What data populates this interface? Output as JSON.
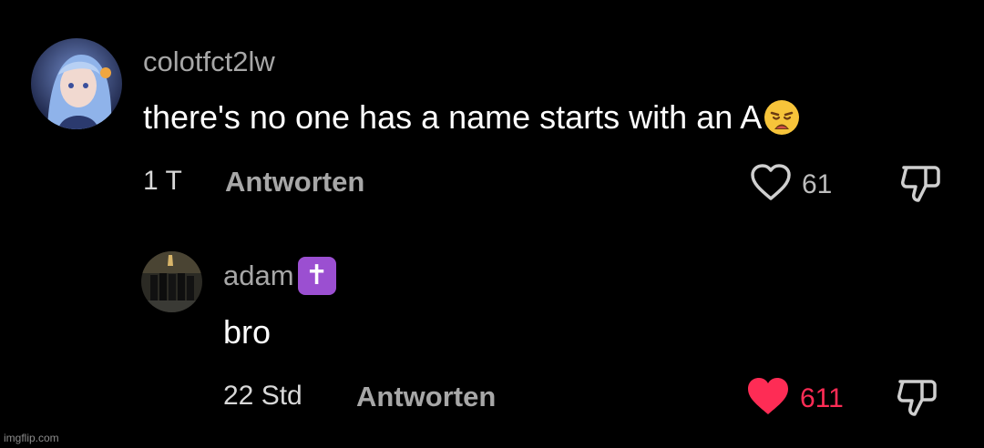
{
  "comments": [
    {
      "username": "colotfct2lw",
      "text": "there's no one has a name starts with an A",
      "text_emoji": "weary-face",
      "timestamp": "1 T",
      "reply_label": "Antworten",
      "likes": "61",
      "liked": false
    },
    {
      "username": "adam",
      "username_badge": "✝",
      "text": "bro",
      "timestamp": "22 Std",
      "reply_label": "Antworten",
      "likes": "611",
      "liked": true
    }
  ],
  "watermark": "imgflip.com",
  "colors": {
    "background": "#000000",
    "username": "#a7a7a7",
    "liked_heart": "#fe2c55",
    "badge": "#9b4fd1"
  }
}
